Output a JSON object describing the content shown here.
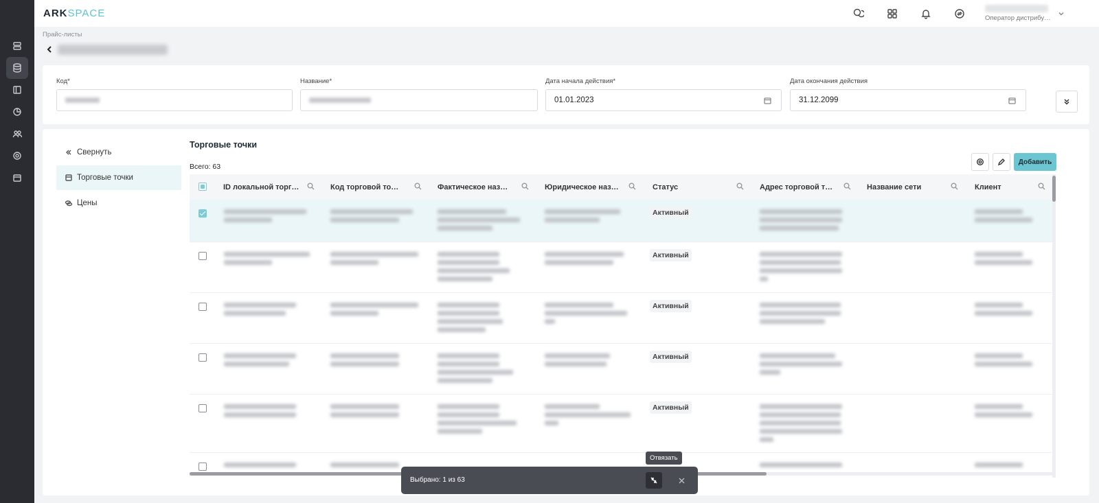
{
  "app": {
    "logo_main": "ARK",
    "logo_accent": "SPACE"
  },
  "user": {
    "role": "Оператор дистрибу…"
  },
  "breadcrumb": "Прайс-листы",
  "form": {
    "code_label": "Код*",
    "name_label": "Название*",
    "start_label": "Дата начала действия*",
    "start_value": "01.01.2023",
    "end_label": "Дата окончания действия",
    "end_value": "31.12.2099"
  },
  "sidebar": {
    "collapse_label": "Свернуть",
    "items": [
      {
        "label": "Торговые точки",
        "active": true
      },
      {
        "label": "Цены",
        "active": false
      }
    ]
  },
  "section": {
    "title": "Торговые точки",
    "total": "Всего: 63",
    "add_label": "Добавить"
  },
  "table": {
    "columns": [
      "ID локальной торг…",
      "Код торговой то…",
      "Фактическое наз…",
      "Юридическое наз…",
      "Статус",
      "Адрес торговой т…",
      "Название сети",
      "Клиент"
    ],
    "rows": [
      {
        "checked": true,
        "status": "Активный"
      },
      {
        "checked": false,
        "status": "Активный"
      },
      {
        "checked": false,
        "status": "Активный"
      },
      {
        "checked": false,
        "status": "Активный"
      },
      {
        "checked": false,
        "status": "Активный"
      },
      {
        "checked": false,
        "status": ""
      }
    ]
  },
  "selection_bar": {
    "text": "Выбрано: 1 из 63",
    "tooltip": "Отвязать"
  },
  "colors": {
    "accent": "#6cc6d1",
    "rail": "#2a2c31",
    "selected_row": "#eaf6f8"
  }
}
